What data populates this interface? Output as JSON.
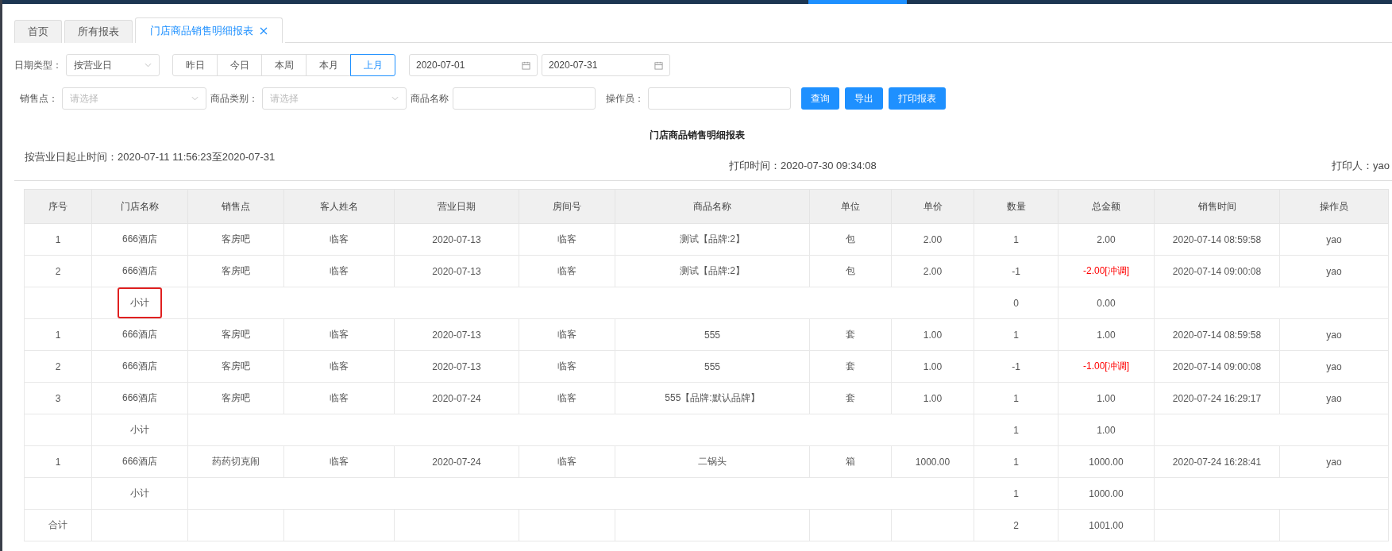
{
  "tabs": [
    {
      "label": "首页",
      "selected": false,
      "closable": false
    },
    {
      "label": "所有报表",
      "selected": false,
      "closable": false
    },
    {
      "label": "门店商品销售明细报表",
      "selected": true,
      "closable": true
    }
  ],
  "filters": {
    "date_type": {
      "label": "日期类型：",
      "value": "按营业日"
    },
    "quick_ranges": [
      {
        "label": "昨日",
        "selected": false
      },
      {
        "label": "今日",
        "selected": false
      },
      {
        "label": "本周",
        "selected": false
      },
      {
        "label": "本月",
        "selected": false
      },
      {
        "label": "上月",
        "selected": true
      }
    ],
    "date_start": "2020-07-01",
    "date_end": "2020-07-31",
    "sales_point": {
      "label": "销售点：",
      "placeholder": "请选择"
    },
    "category": {
      "label": "商品类别：",
      "placeholder": "请选择"
    },
    "product_name": {
      "label": "商品名称"
    },
    "operator": {
      "label": "操作员："
    },
    "buttons": [
      "查询",
      "导出",
      "打印报表"
    ]
  },
  "report": {
    "title": "门店商品销售明细报表",
    "range": "按营业日起止时间：2020-07-11 11:56:23至2020-07-31",
    "print_time": "打印时间：2020-07-30 09:34:08",
    "printer": "打印人：yao"
  },
  "table": {
    "columns": [
      "序号",
      "门店名称",
      "销售点",
      "客人姓名",
      "营业日期",
      "房间号",
      "商品名称",
      "单位",
      "单价",
      "数量",
      "总金额",
      "销售时间",
      "操作员"
    ],
    "rows": [
      {
        "kind": "item",
        "cells": [
          "1",
          "666酒店",
          "客房吧",
          "临客",
          "2020-07-13",
          "临客",
          "测试【品牌:2】",
          "包",
          "2.00",
          "1",
          "2.00",
          "2020-07-14 08:59:58",
          "yao"
        ],
        "adjustment": false
      },
      {
        "kind": "item",
        "cells": [
          "2",
          "666酒店",
          "客房吧",
          "临客",
          "2020-07-13",
          "临客",
          "测试【品牌:2】",
          "包",
          "2.00",
          "-1",
          "-2.00[冲调]",
          "2020-07-14 09:00:08",
          "yao"
        ],
        "adjustment": true
      },
      {
        "kind": "subtotal",
        "label": "小计",
        "quantity": "0",
        "amount": "0.00",
        "highlighted": true
      },
      {
        "kind": "item",
        "cells": [
          "1",
          "666酒店",
          "客房吧",
          "临客",
          "2020-07-13",
          "临客",
          "555",
          "套",
          "1.00",
          "1",
          "1.00",
          "2020-07-14 08:59:58",
          "yao"
        ],
        "adjustment": false
      },
      {
        "kind": "item",
        "cells": [
          "2",
          "666酒店",
          "客房吧",
          "临客",
          "2020-07-13",
          "临客",
          "555",
          "套",
          "1.00",
          "-1",
          "-1.00[冲调]",
          "2020-07-14 09:00:08",
          "yao"
        ],
        "adjustment": true
      },
      {
        "kind": "item",
        "cells": [
          "3",
          "666酒店",
          "客房吧",
          "临客",
          "2020-07-24",
          "临客",
          "555【品牌:默认品牌】",
          "套",
          "1.00",
          "1",
          "1.00",
          "2020-07-24 16:29:17",
          "yao"
        ],
        "adjustment": false
      },
      {
        "kind": "subtotal",
        "label": "小计",
        "quantity": "1",
        "amount": "1.00",
        "highlighted": false
      },
      {
        "kind": "item",
        "cells": [
          "1",
          "666酒店",
          "药药切克闹",
          "临客",
          "2020-07-24",
          "临客",
          "二锅头",
          "箱",
          "1000.00",
          "1",
          "1000.00",
          "2020-07-24 16:28:41",
          "yao"
        ],
        "adjustment": false
      },
      {
        "kind": "subtotal",
        "label": "小计",
        "quantity": "1",
        "amount": "1000.00",
        "highlighted": false
      },
      {
        "kind": "total",
        "label": "合计",
        "quantity": "2",
        "amount": "1001.00"
      }
    ]
  }
}
